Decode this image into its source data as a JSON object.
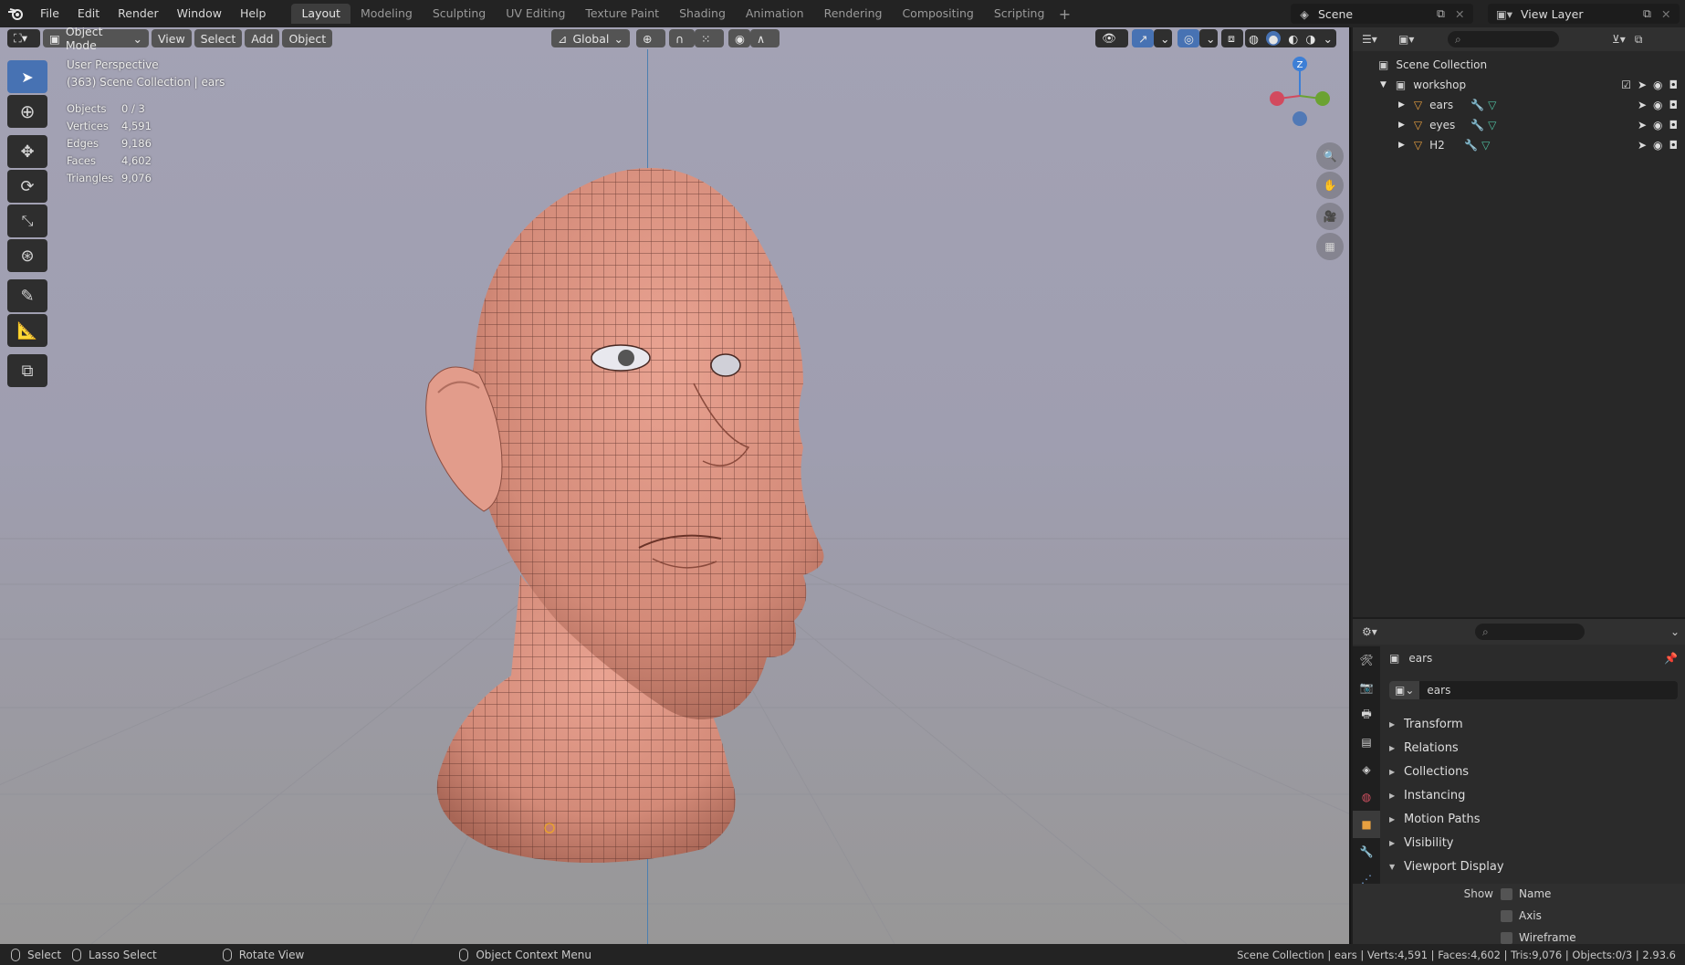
{
  "menu": [
    "File",
    "Edit",
    "Render",
    "Window",
    "Help"
  ],
  "workspaces": [
    "Layout",
    "Modeling",
    "Sculpting",
    "UV Editing",
    "Texture Paint",
    "Shading",
    "Animation",
    "Rendering",
    "Compositing",
    "Scripting"
  ],
  "active_workspace": "Layout",
  "scene": "Scene",
  "view_layer": "View Layer",
  "viewport": {
    "mode": "Object Mode",
    "menus": [
      "View",
      "Select",
      "Add",
      "Object"
    ],
    "orientation": "Global",
    "perspective_label": "User Perspective",
    "collection_label": "(363) Scene Collection | ears",
    "stats": [
      {
        "label": "Objects",
        "value": "0 / 3"
      },
      {
        "label": "Vertices",
        "value": "4,591"
      },
      {
        "label": "Edges",
        "value": "9,186"
      },
      {
        "label": "Faces",
        "value": "4,602"
      },
      {
        "label": "Triangles",
        "value": "9,076"
      }
    ],
    "gizmo_axis": "Z"
  },
  "outliner": {
    "root": "Scene Collection",
    "collection": "workshop",
    "objects": [
      "ears",
      "eyes",
      "H2"
    ]
  },
  "properties": {
    "object_name": "ears",
    "datablock_name": "ears",
    "panels": [
      "Transform",
      "Relations",
      "Collections",
      "Instancing",
      "Motion Paths",
      "Visibility",
      "Viewport Display"
    ],
    "show_label": "Show",
    "show_options": [
      "Name",
      "Axis",
      "Wireframe"
    ]
  },
  "statusbar": {
    "select": "Select",
    "lasso": "Lasso Select",
    "rotate": "Rotate View",
    "context": "Object Context Menu",
    "info": "Scene Collection | ears | Verts:4,591 | Faces:4,602 | Tris:9,076 | Objects:0/3 | 2.93.6"
  },
  "colors": {
    "accent": "#4772b3",
    "skin": "#d98f7f",
    "axis_x": "#d24a5e",
    "axis_y": "#6ba232",
    "axis_z": "#3d7fd6"
  }
}
